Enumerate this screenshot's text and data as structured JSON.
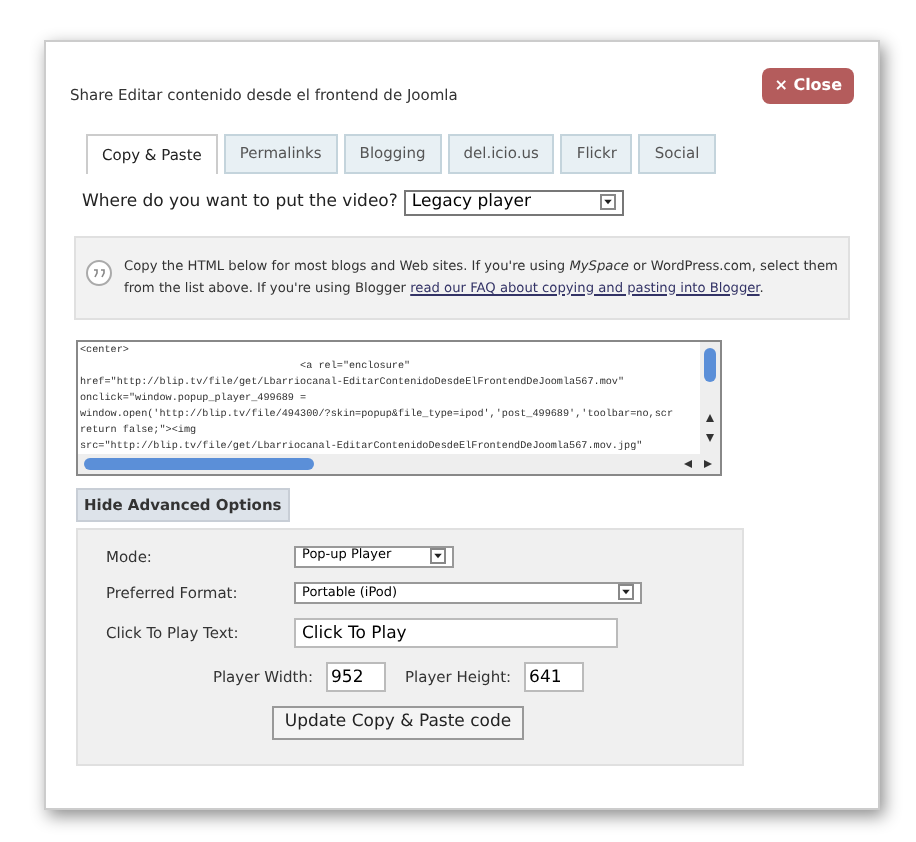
{
  "dialog": {
    "title": "Share Editar contenido desde el frontend de Joomla",
    "close_button": "× Close"
  },
  "tabs": [
    {
      "label": "Copy & Paste",
      "selected": true
    },
    {
      "label": "Permalinks",
      "selected": false
    },
    {
      "label": "Blogging",
      "selected": false
    },
    {
      "label": "del.icio.us",
      "selected": false
    },
    {
      "label": "Flickr",
      "selected": false
    },
    {
      "label": "Social",
      "selected": false
    }
  ],
  "placement": {
    "label": "Where do you want to put the video?",
    "value": "Legacy player"
  },
  "info": {
    "text": "Copy the HTML below for most blogs and Web sites. If you're using *MySpace* or WordPress.com, select them from the list above. If you're using Blogger",
    "link": "read our FAQ about copying and pasting into Blogger",
    "end": "."
  },
  "code_lines": [
    "<center>",
    "                                    <a rel=\"enclosure\"",
    "href=\"http://blip.tv/file/get/Lbarriocanal-EditarContenidoDesdeElFrontendDeJoomla567.mov\"",
    "onclick=\"window.popup_player_499689 =",
    "window.open('http://blip.tv/file/494300/?skin=popup&file_type=ipod','post_499689','toolbar=no,scr",
    "return false;\"><img",
    "src=\"http://blip.tv/file/get/Lbarriocanal-EditarContenidoDesdeElFrontendDeJoomla567.mov.jpg\""
  ],
  "advanced_toggle": "Hide Advanced Options",
  "advanced": {
    "fields": [
      {
        "kind": "select",
        "label": "Mode:",
        "value": "Pop-up Player",
        "wide": false
      },
      {
        "kind": "select",
        "label": "Preferred Format:",
        "value": "Portable (iPod)",
        "wide": true
      },
      {
        "kind": "text",
        "label": "Click To Play Text:",
        "value": "Click To Play"
      }
    ],
    "width_label": "Player Width:",
    "width_value": "952",
    "height_label": "Player Height:",
    "height_value": "641",
    "update_button": "Update Copy & Paste code"
  }
}
